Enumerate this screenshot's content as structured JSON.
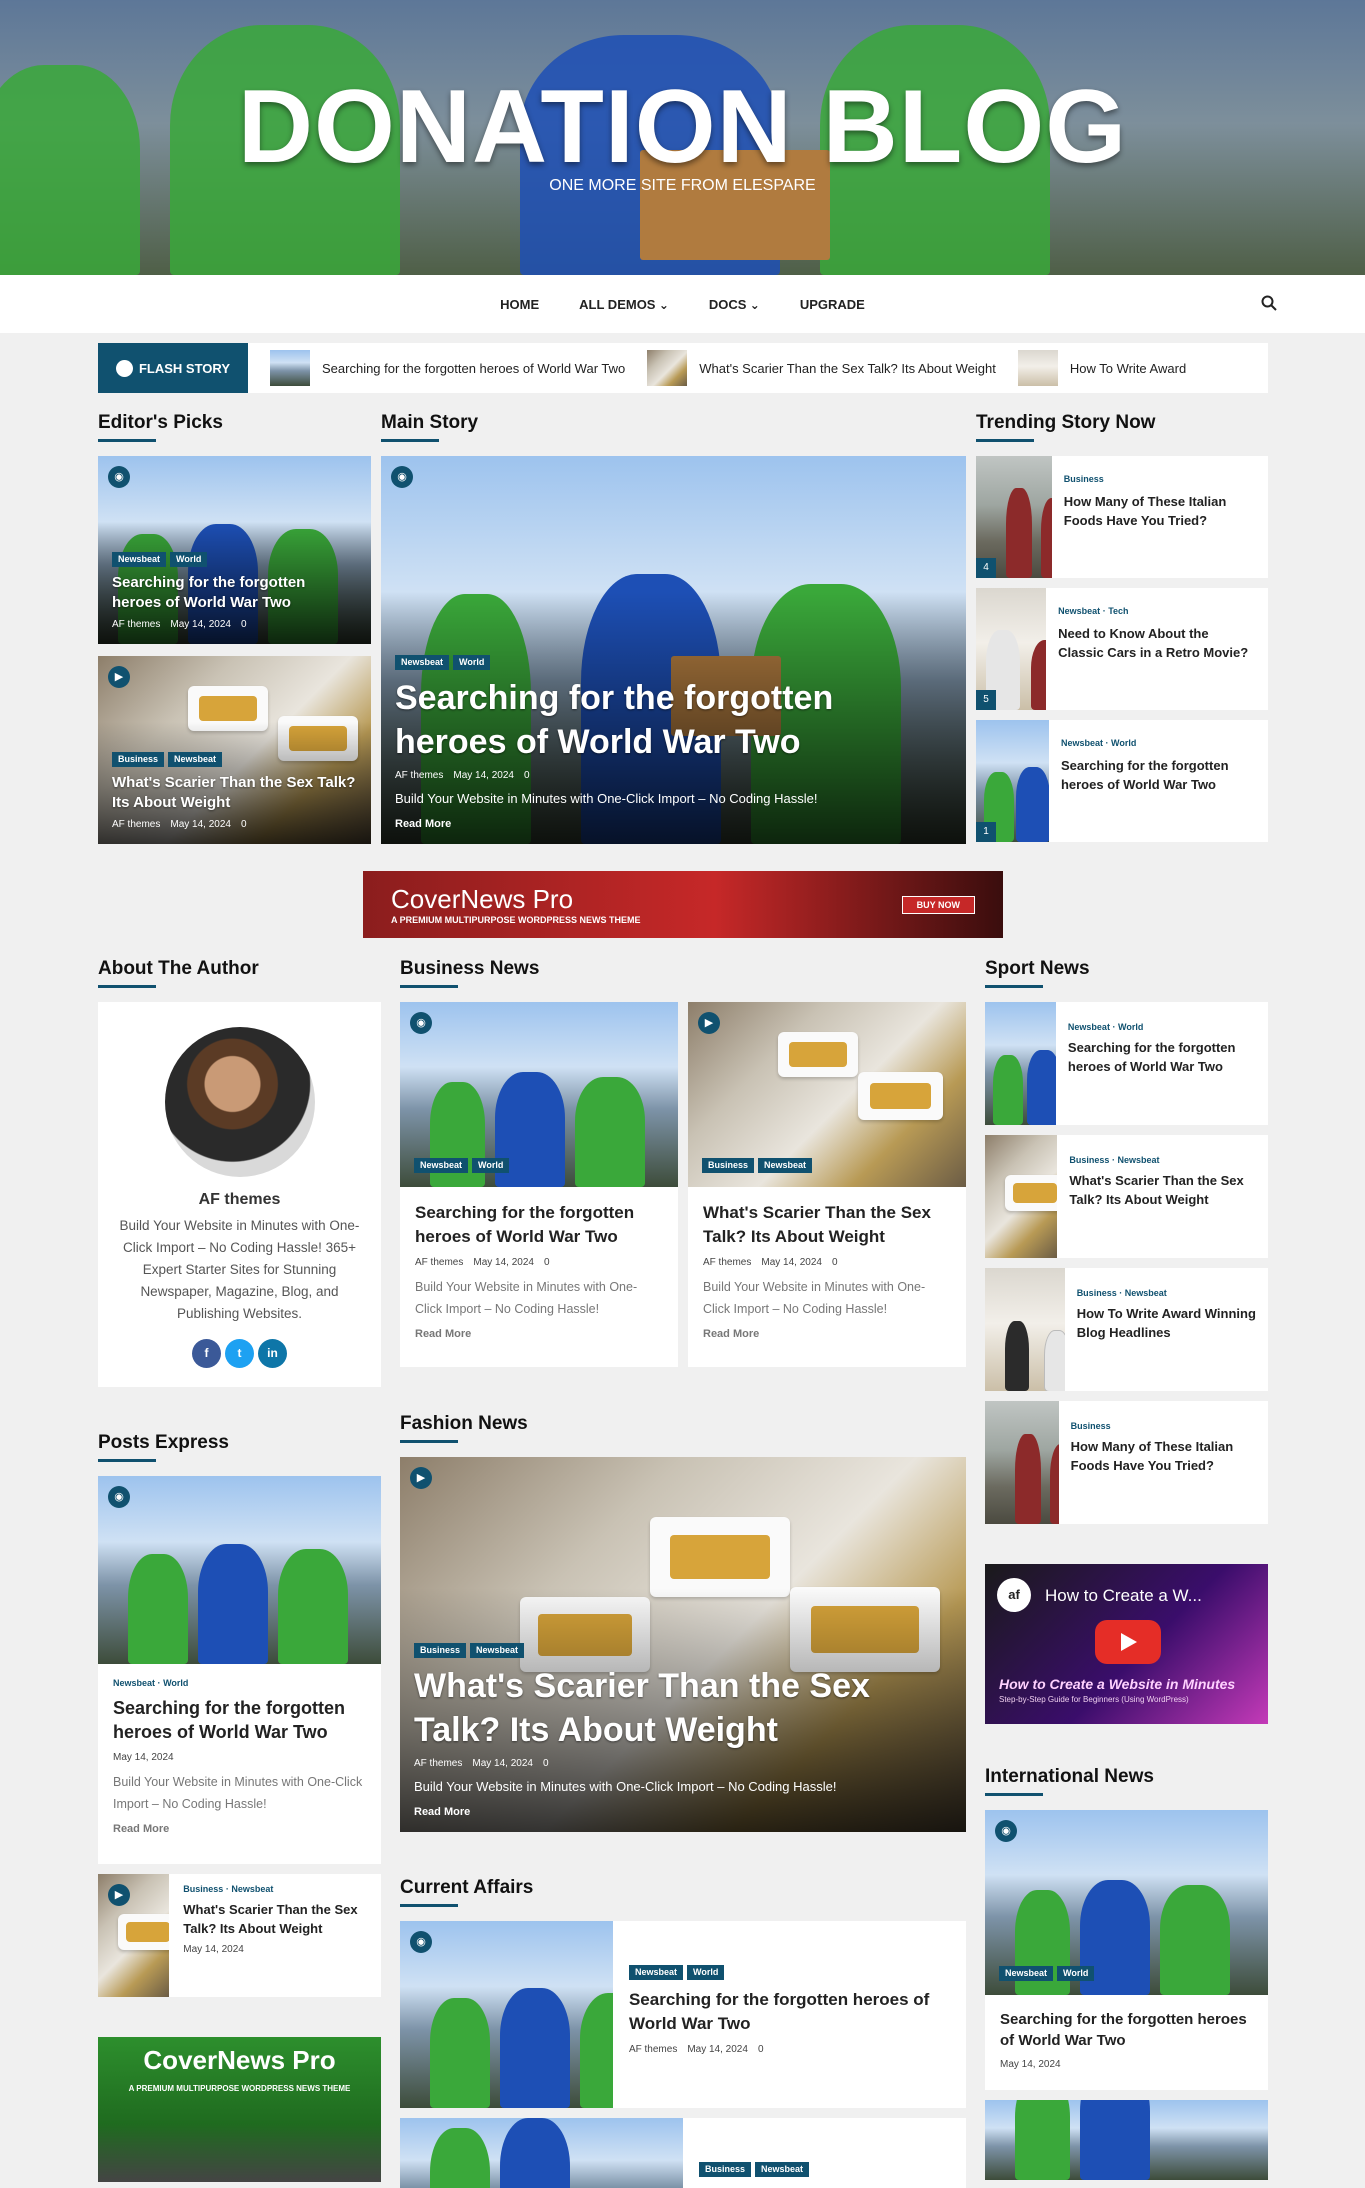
{
  "site": {
    "title": "DONATION BLOG",
    "tagline": "ONE MORE SITE FROM ELESPARE"
  },
  "nav": {
    "items": [
      "HOME",
      "ALL DEMOS",
      "DOCS",
      "UPGRADE"
    ]
  },
  "flash": {
    "label": "FLASH STORY",
    "items": [
      "Searching for the forgotten heroes of World War Two",
      "What's Scarier Than the Sex Talk? Its About Weight",
      "How To Write Award"
    ]
  },
  "common": {
    "author": "AF themes",
    "date": "May 14, 2024",
    "comments": "0",
    "excerpt": "Build Your Website in Minutes with One-Click Import – No Coding Hassle!",
    "read_more": "Read More",
    "separator": "·"
  },
  "editors": {
    "title": "Editor's Picks",
    "posts": [
      {
        "tags": [
          "Newsbeat",
          "World"
        ],
        "title": "Searching for the forgotten heroes of World War Two"
      },
      {
        "tags": [
          "Business",
          "Newsbeat"
        ],
        "title": "What's Scarier Than the Sex Talk? Its About Weight"
      }
    ]
  },
  "main": {
    "title": "Main Story",
    "post": {
      "tags": [
        "Newsbeat",
        "World"
      ],
      "title": "Searching for the forgotten heroes of World War Two"
    }
  },
  "trending": {
    "title": "Trending Story Now",
    "posts": [
      {
        "cats": [
          "Business"
        ],
        "title": "How Many of These Italian Foods Have You Tried?",
        "rank": "4"
      },
      {
        "cats": [
          "Newsbeat",
          "Tech"
        ],
        "title": "Need to Know About the Classic Cars in a Retro Movie?",
        "rank": "5"
      },
      {
        "cats": [
          "Newsbeat",
          "World"
        ],
        "title": "Searching for the forgotten heroes of World War Two",
        "rank": "1"
      }
    ]
  },
  "banner": {
    "brand": "CoverNews Pro",
    "sub": "A PREMIUM MULTIPURPOSE WORDPRESS NEWS THEME",
    "cta": "BUY NOW"
  },
  "about": {
    "title": "About The Author",
    "name": "AF themes",
    "bio": "Build Your Website in Minutes with One-Click Import – No Coding Hassle! 365+ Expert Starter Sites for Stunning Newspaper, Magazine, Blog, and Publishing Websites.",
    "social": [
      "f",
      "t",
      "in"
    ]
  },
  "business": {
    "title": "Business News",
    "posts": [
      {
        "tags": [
          "Newsbeat",
          "World"
        ],
        "title": "Searching for the forgotten heroes of World War Two"
      },
      {
        "tags": [
          "Business",
          "Newsbeat"
        ],
        "title": "What's Scarier Than the Sex Talk? Its About Weight"
      }
    ]
  },
  "sport": {
    "title": "Sport News",
    "posts": [
      {
        "cats": [
          "Newsbeat",
          "World"
        ],
        "title": "Searching for the forgotten heroes of World War Two"
      },
      {
        "cats": [
          "Business",
          "Newsbeat"
        ],
        "title": "What's Scarier Than the Sex Talk? Its About Weight"
      },
      {
        "cats": [
          "Business",
          "Newsbeat"
        ],
        "title": "How To Write Award Winning Blog Headlines"
      },
      {
        "cats": [
          "Business"
        ],
        "title": "How Many of These Italian Foods Have You Tried?"
      }
    ]
  },
  "video": {
    "title": "How to Create a W...",
    "caption": "How to Create a Website in Minutes",
    "sub": "Step-by-Step Guide for Beginners (Using WordPress)"
  },
  "express": {
    "title": "Posts Express",
    "main": {
      "cats": [
        "Newsbeat",
        "World"
      ],
      "title": "Searching for the forgotten heroes of World War Two"
    },
    "small": {
      "cats": [
        "Business",
        "Newsbeat"
      ],
      "title": "What's Scarier Than the Sex Talk? Its About Weight"
    }
  },
  "fashion": {
    "title": "Fashion News",
    "post": {
      "tags": [
        "Business",
        "Newsbeat"
      ],
      "title": "What's Scarier Than the Sex Talk? Its About Weight"
    }
  },
  "current": {
    "title": "Current Affairs",
    "posts": [
      {
        "tags": [
          "Newsbeat",
          "World"
        ],
        "title": "Searching for the forgotten heroes of World War Two"
      },
      {
        "tags": [
          "Business",
          "Newsbeat"
        ],
        "title": ""
      }
    ]
  },
  "international": {
    "title": "International News",
    "post": {
      "tags": [
        "Newsbeat",
        "World"
      ],
      "title": "Searching for the forgotten heroes of World War Two"
    }
  },
  "promo": {
    "brand": "CoverNews Pro",
    "sub": "A PREMIUM MULTIPURPOSE WORDPRESS NEWS THEME"
  },
  "colors": {
    "primary": "#10516f",
    "accent": "#c62828"
  }
}
